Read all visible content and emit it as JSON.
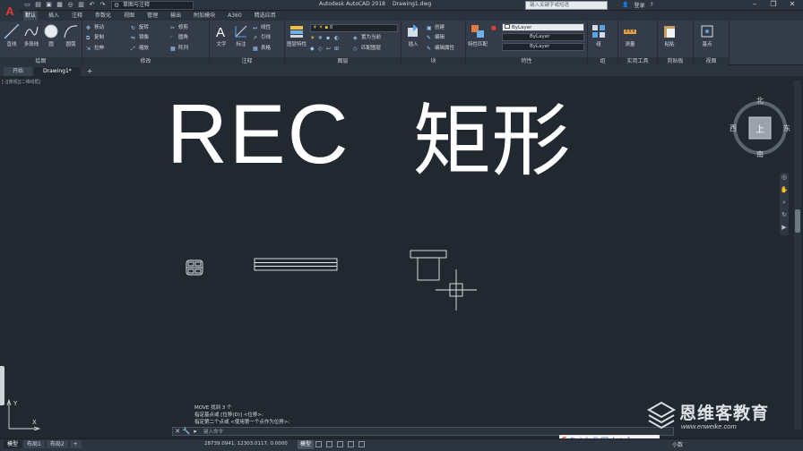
{
  "app": {
    "logo": "A",
    "title": "Autodesk AutoCAD 2018",
    "file": "Drawing1.dwg",
    "workspace": "草图与注释",
    "search_placeholder": "键入关键字或短语",
    "user": "登录"
  },
  "menu_tabs": [
    "默认",
    "插入",
    "注释",
    "参数化",
    "视图",
    "管理",
    "输出",
    "附加模块",
    "A360",
    "精选应用"
  ],
  "ribbon": {
    "draw": {
      "label": "绘图",
      "tools": [
        "直线",
        "多段线",
        "圆",
        "圆弧"
      ]
    },
    "modify": {
      "label": "修改",
      "tools": [
        "移动",
        "旋转",
        "修剪",
        "复制",
        "镜像",
        "圆角",
        "拉伸",
        "缩放",
        "阵列"
      ]
    },
    "annotation": {
      "label": "注释",
      "tools": [
        "文字",
        "标注",
        "线性",
        "引线",
        "表格"
      ]
    },
    "layers": {
      "label": "图层",
      "tools": [
        "图层特性",
        "置为当前",
        "匹配图层"
      ],
      "current": "0"
    },
    "block": {
      "label": "块",
      "tools": [
        "插入",
        "创建",
        "编辑",
        "编辑属性"
      ]
    },
    "properties": {
      "label": "特性",
      "tools": [
        "特性匹配"
      ],
      "bylayer": [
        "ByLayer",
        "ByLayer",
        "ByLayer"
      ]
    },
    "groups": {
      "label": "组",
      "tools": [
        "组"
      ]
    },
    "utilities": {
      "label": "实用工具",
      "tools": [
        "测量"
      ]
    },
    "clipboard": {
      "label": "剪贴板",
      "tools": [
        "粘贴"
      ]
    },
    "view": {
      "label": "视图",
      "tools": [
        "基点"
      ]
    }
  },
  "file_tabs": [
    "开始",
    "Drawing1*",
    "+"
  ],
  "viewport_label": "[-][俯视][二维线框]",
  "overlay": {
    "en": "REC",
    "zh": "矩形"
  },
  "viewcube": {
    "top": "上",
    "north": "北",
    "south": "南",
    "east": "东",
    "west": "西"
  },
  "command_history": [
    "MOVE 找到 3 个",
    "指定基点或 [位移(D)] <位移>:",
    "指定第二个点或 <使用第一个点作为位移>:"
  ],
  "command_prompt": "键入命令",
  "layout_tabs": [
    "模型",
    "布局1",
    "布局2"
  ],
  "coords": "28739.0941, 12303.0117, 0.0000",
  "model_label": "模型",
  "decimal_label": "小数",
  "watermark": {
    "name": "恩维客教育",
    "url": "www.enweike.com"
  },
  "ime": {
    "logo": "S",
    "lang": "中"
  }
}
